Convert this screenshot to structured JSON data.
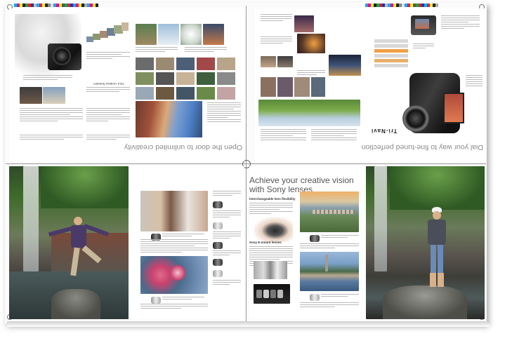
{
  "spread_top_left": {
    "heading": "Open the door to unlimited creativity",
    "sections": [
      "Take precise control",
      "Never miss the moment",
      "Your creative freedom",
      "Capture everything"
    ]
  },
  "spread_top_right": {
    "heading": "Dial your way to fine-tuned perfection",
    "sections": [
      "Tri-Navi",
      "Intuitive control"
    ]
  },
  "spread_bottom_right": {
    "heading_line1": "Achieve your creative vision",
    "heading_line2": "with Sony lenses",
    "subheads": [
      "Interchangeable lens flexibility",
      "Sony E-mount lenses"
    ]
  },
  "colors": {
    "sky": "#4d7fc4",
    "foliage": "#3f6b2a",
    "rock": "#5a554e",
    "flower": "#c9426e"
  }
}
